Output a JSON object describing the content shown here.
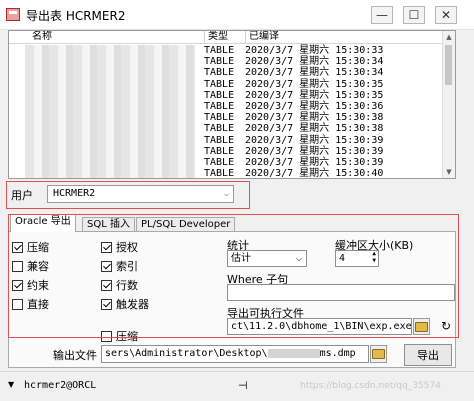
{
  "window": {
    "title": "导出表 HCRMER2",
    "min": "—",
    "max": "☐",
    "close": "✕"
  },
  "list": {
    "columns": [
      "名称",
      "类型",
      "已编译"
    ],
    "rows": [
      {
        "type": "TABLE",
        "date": "2020/3/7 星期六 15:30:33"
      },
      {
        "type": "TABLE",
        "date": "2020/3/7 星期六 15:30:34"
      },
      {
        "type": "TABLE",
        "date": "2020/3/7 星期六 15:30:34"
      },
      {
        "type": "TABLE",
        "date": "2020/3/7 星期六 15:30:35"
      },
      {
        "type": "TABLE",
        "date": "2020/3/7 星期六 15:30:35"
      },
      {
        "type": "TABLE",
        "date": "2020/3/7 星期六 15:30:36"
      },
      {
        "type": "TABLE",
        "date": "2020/3/7 星期六 15:30:38"
      },
      {
        "type": "TABLE",
        "date": "2020/3/7 星期六 15:30:38"
      },
      {
        "type": "TABLE",
        "date": "2020/3/7 星期六 15:30:39"
      },
      {
        "type": "TABLE",
        "date": "2020/3/7 星期六 15:30:39"
      },
      {
        "type": "TABLE",
        "date": "2020/3/7 星期六 15:30:39"
      },
      {
        "type": "TABLE",
        "date": "2020/3/7 星期六 15:30:40"
      }
    ]
  },
  "user": {
    "label": "用户",
    "value": "HCRMER2"
  },
  "tabs": [
    "Oracle 导出",
    "SQL 插入",
    "PL/SQL Developer"
  ],
  "options": {
    "col1": [
      {
        "label": "压缩",
        "checked": true
      },
      {
        "label": "兼容",
        "checked": false
      },
      {
        "label": "约束",
        "checked": true
      },
      {
        "label": "直接",
        "checked": false
      }
    ],
    "col2": [
      {
        "label": "授权",
        "checked": true
      },
      {
        "label": "索引",
        "checked": true
      },
      {
        "label": "行数",
        "checked": true
      },
      {
        "label": "触发器",
        "checked": true
      }
    ],
    "compress2": {
      "label": "压缩",
      "checked": false
    },
    "statistics_label": "统计",
    "statistics_value": "估计",
    "buffer_label": "缓冲区大小(KB)",
    "buffer_value": "4",
    "where_label": "Where 子句",
    "where_value": "",
    "exe_label": "导出可执行文件",
    "exe_value": "ct\\11.2.0\\dbhome_1\\BIN\\exp.exe"
  },
  "output": {
    "label": "输出文件",
    "value": "sers\\Administrator\\Desktop\\",
    "value_suffix": "ms.dmp",
    "export_button": "导出"
  },
  "status": {
    "connection": "hcrmer2@ORCL",
    "watermark": "https://blog.csdn.net/qq_35574"
  },
  "colors": {
    "highlight_border": "#e05050"
  }
}
